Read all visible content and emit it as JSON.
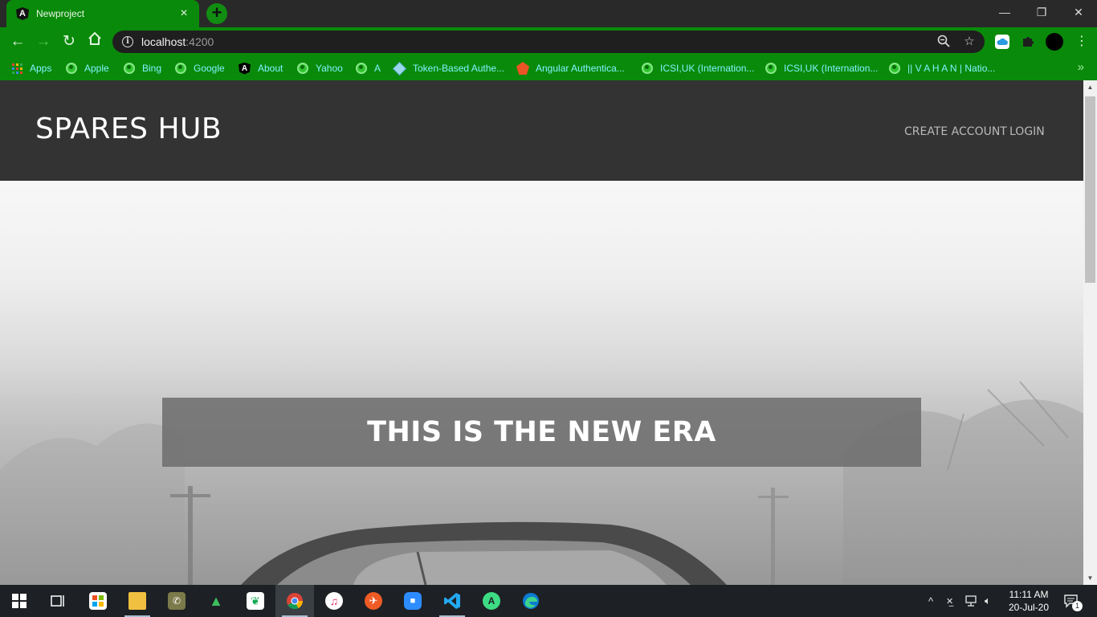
{
  "browser": {
    "tab_title": "Newproject",
    "tab_favicon": "A",
    "url_host": "localhost",
    "url_port": ":4200",
    "window_controls": {
      "minimize": "—",
      "restore": "❐",
      "close": "✕"
    }
  },
  "bookmarks": [
    {
      "label": "Apps",
      "icon": "apps-grid-icon"
    },
    {
      "label": "Apple",
      "icon": "globe-icon"
    },
    {
      "label": "Bing",
      "icon": "globe-icon"
    },
    {
      "label": "Google",
      "icon": "globe-icon"
    },
    {
      "label": "About",
      "icon": "angular-icon"
    },
    {
      "label": "Yahoo",
      "icon": "globe-icon"
    },
    {
      "label": "A",
      "icon": "globe-icon"
    },
    {
      "label": "Token-Based Authe...",
      "icon": "cube-icon"
    },
    {
      "label": "Angular Authentica...",
      "icon": "auth0-icon"
    },
    {
      "label": "ICSI,UK (Internation...",
      "icon": "globe-icon"
    },
    {
      "label": "ICSI,UK (Internation...",
      "icon": "globe-icon"
    },
    {
      "label": "|| V A H A N | Natio...",
      "icon": "globe-icon"
    }
  ],
  "site": {
    "brand": "SPARES HUB",
    "nav": {
      "create_account": "CREATE ACCOUNT",
      "login": "LOGIN"
    },
    "hero_title": "THIS IS THE NEW ERA"
  },
  "taskbar": {
    "apps": [
      "windows-start-icon",
      "task-view-icon",
      "store-icon",
      "file-explorer-icon",
      "whatsapp-icon",
      "robo3t-icon",
      "mongodb-compass-icon",
      "chrome-icon",
      "itunes-icon",
      "postman-icon",
      "zoom-icon",
      "vscode-icon",
      "android-studio-icon",
      "edge-icon"
    ],
    "time": "11:11 AM",
    "date": "20-Jul-20",
    "notification_count": "1"
  },
  "colors": {
    "chrome_green": "#0a8a0a",
    "header_bg": "#333333",
    "bookmark_text": "#7ff3ff"
  }
}
